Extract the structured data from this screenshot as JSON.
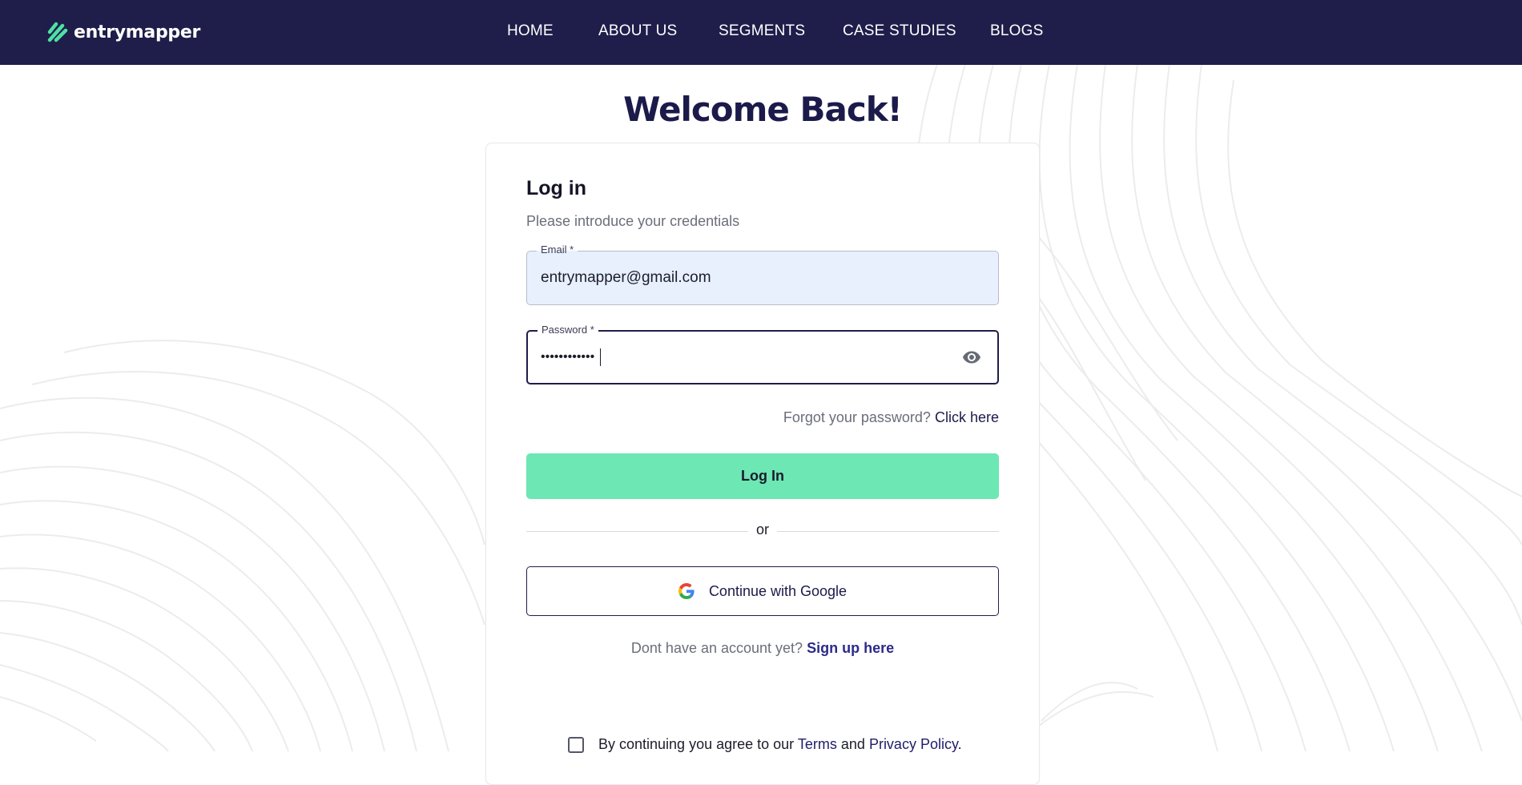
{
  "brand": {
    "name": "entrymapper",
    "colors": {
      "navy": "#1f1d4a",
      "mint": "#6de7b3",
      "logo_mark": "#4fe0a4"
    }
  },
  "nav": {
    "items": [
      "HOME",
      "ABOUT US",
      "SEGMENTS",
      "CASE STUDIES",
      "BLOGS"
    ]
  },
  "page": {
    "title": "Welcome Back!"
  },
  "login": {
    "heading": "Log in",
    "subtitle": "Please introduce your credentials",
    "email": {
      "label": "Email *",
      "value": "entrymapper@gmail.com"
    },
    "password": {
      "label": "Password *",
      "value": "••••••••••••",
      "toggle_icon": "eye-icon"
    },
    "forgot": {
      "text": "Forgot your password?",
      "link": "Click here"
    },
    "submit_label": "Log In",
    "divider_text": "or",
    "google": {
      "label": "Continue with Google",
      "icon": "google-icon"
    },
    "signup": {
      "text": "Dont have an account yet?",
      "link": "Sign up here"
    },
    "consent": {
      "prefix": "By continuing you agree to our",
      "terms": "Terms",
      "and": "and",
      "privacy": "Privacy Policy",
      "suffix": "."
    }
  }
}
